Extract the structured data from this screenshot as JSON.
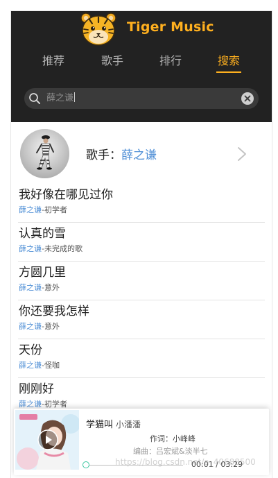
{
  "app": {
    "brand": "Tiger Music"
  },
  "tabs": [
    {
      "label": "推荐",
      "active": false
    },
    {
      "label": "歌手",
      "active": false
    },
    {
      "label": "排行",
      "active": false
    },
    {
      "label": "搜索",
      "active": true
    }
  ],
  "search": {
    "value": "薛之谦"
  },
  "singer": {
    "label": "歌手：",
    "name": "薛之谦"
  },
  "songs": [
    {
      "title": "我好像在哪见过你",
      "artist": "薛之谦",
      "album": "-初学者"
    },
    {
      "title": "认真的雪",
      "artist": "薛之谦",
      "album": "-未完成的歌"
    },
    {
      "title": "方圆几里",
      "artist": "薛之谦",
      "album": "-意外"
    },
    {
      "title": "你还要我怎样",
      "artist": "薛之谦",
      "album": "-意外"
    },
    {
      "title": "天份",
      "artist": "薛之谦",
      "album": "-怪咖"
    },
    {
      "title": "刚刚好",
      "artist": "薛之谦",
      "album": "-初学者"
    }
  ],
  "player": {
    "title": "学猫叫",
    "artist": "小潘潘",
    "lyric_line_1": "作词：小峰峰",
    "lyric_line_2": "编曲：吕宏斌&淡半七",
    "time": "00:01 / 03:29",
    "progress": 0.005
  },
  "watermark": "https://blog.csdn.net/a_40688500",
  "colors": {
    "header_bg": "#222222",
    "accent": "#ffb01f",
    "link": "#4f8fd6",
    "progress_knob": "#3ac7a0"
  },
  "icons": {
    "logo": "tiger-face-icon",
    "search": "search-icon",
    "clear": "clear-circle-icon",
    "chevron": "chevron-right-icon",
    "play": "play-icon"
  }
}
